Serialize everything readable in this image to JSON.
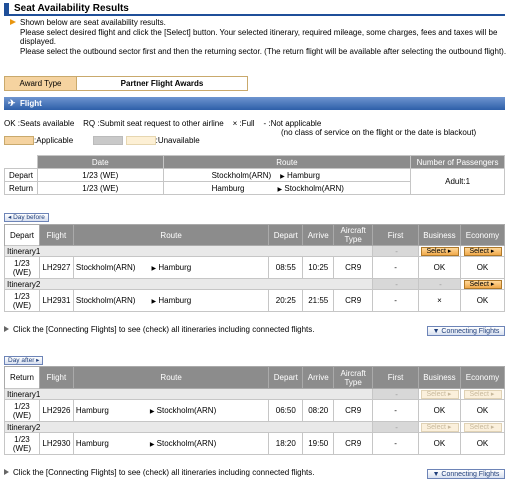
{
  "page_title": "Seat Availability Results",
  "intro": [
    "Shown below are seat availability results.",
    "Please select desired flight and click the [Select] button. Your selected itinerary, required mileage, some charges, fees and taxes will be displayed.",
    "Please select the outbound sector first and then the returning sector. (The return flight will be available after selecting the outbound flight)."
  ],
  "award": {
    "label": "Award Type",
    "value": "Partner Flight Awards"
  },
  "flight_section": {
    "title": "Flight",
    "icon": "airplane-icon"
  },
  "legend": {
    "ok": "OK :Seats available",
    "rq": "RQ :Submit seat request to other airline",
    "full": "× :Full",
    "na": "- :Not applicable",
    "na_note": "(no class of service on the flight or the date is blackout)",
    "applicable": ":Applicable",
    "unavailable": ":Unavailable",
    "applicable_color": "#f5d3a0",
    "disabled_color": "#c9c9c9",
    "unavailable_color": "#fdf0d5"
  },
  "summary": {
    "headers": [
      "Date",
      "Route",
      "Number of Passengers"
    ],
    "rows": [
      {
        "label": "Depart",
        "date": "1/23 (WE)",
        "from": "Stockholm(ARN)",
        "to": "Hamburg"
      },
      {
        "label": "Return",
        "date": "1/23 (WE)",
        "from": "Hamburg",
        "to": "Stockholm(ARN)"
      }
    ],
    "passengers": "Adult:1"
  },
  "depart_block": {
    "day_button": "◂ Day before",
    "tab": "Depart",
    "headers": [
      "Flight",
      "Route",
      "Depart",
      "Arrive",
      "Aircraft Type",
      "First",
      "Business",
      "Economy"
    ],
    "itineraries": [
      {
        "name": "Itinerary1",
        "first_btn": "-",
        "business_btn": "Select ▸",
        "economy_btn": "Select ▸",
        "date": "1/23 (WE)",
        "flight": "LH2927",
        "from": "Stockholm(ARN)",
        "to": "Hamburg",
        "dep": "08:55",
        "arr": "10:25",
        "aircraft": "CR9",
        "first": "-",
        "business": "OK",
        "economy": "OK"
      },
      {
        "name": "Itinerary2",
        "first_btn": "-",
        "business_btn": "-",
        "economy_btn": "Select ▸",
        "date": "1/23 (WE)",
        "flight": "LH2931",
        "from": "Stockholm(ARN)",
        "to": "Hamburg",
        "dep": "20:25",
        "arr": "21:55",
        "aircraft": "CR9",
        "first": "-",
        "business": "×",
        "economy": "OK"
      }
    ],
    "note": "Click the [Connecting Flights] to see (check) all itineraries including connected flights.",
    "connecting_button": "▼ Connecting Flights"
  },
  "return_block": {
    "day_button": "Day after ▸",
    "tab": "Return",
    "headers": [
      "Flight",
      "Route",
      "Depart",
      "Arrive",
      "Aircraft Type",
      "First",
      "Business",
      "Economy"
    ],
    "itineraries": [
      {
        "name": "Itinerary1",
        "first_btn": "-",
        "business_btn": "Select ▸",
        "economy_btn": "Select ▸",
        "date": "1/23 (WE)",
        "flight": "LH2926",
        "from": "Hamburg",
        "to": "Stockholm(ARN)",
        "dep": "06:50",
        "arr": "08:20",
        "aircraft": "CR9",
        "first": "-",
        "business": "OK",
        "economy": "OK"
      },
      {
        "name": "Itinerary2",
        "first_btn": "-",
        "business_btn": "Select ▸",
        "economy_btn": "Select ▸",
        "date": "1/23 (WE)",
        "flight": "LH2930",
        "from": "Hamburg",
        "to": "Stockholm(ARN)",
        "dep": "18:20",
        "arr": "19:50",
        "aircraft": "CR9",
        "first": "-",
        "business": "OK",
        "economy": "OK"
      }
    ],
    "note": "Click the [Connecting Flights] to see (check) all itineraries including connected flights.",
    "connecting_button": "▼ Connecting Flights"
  }
}
